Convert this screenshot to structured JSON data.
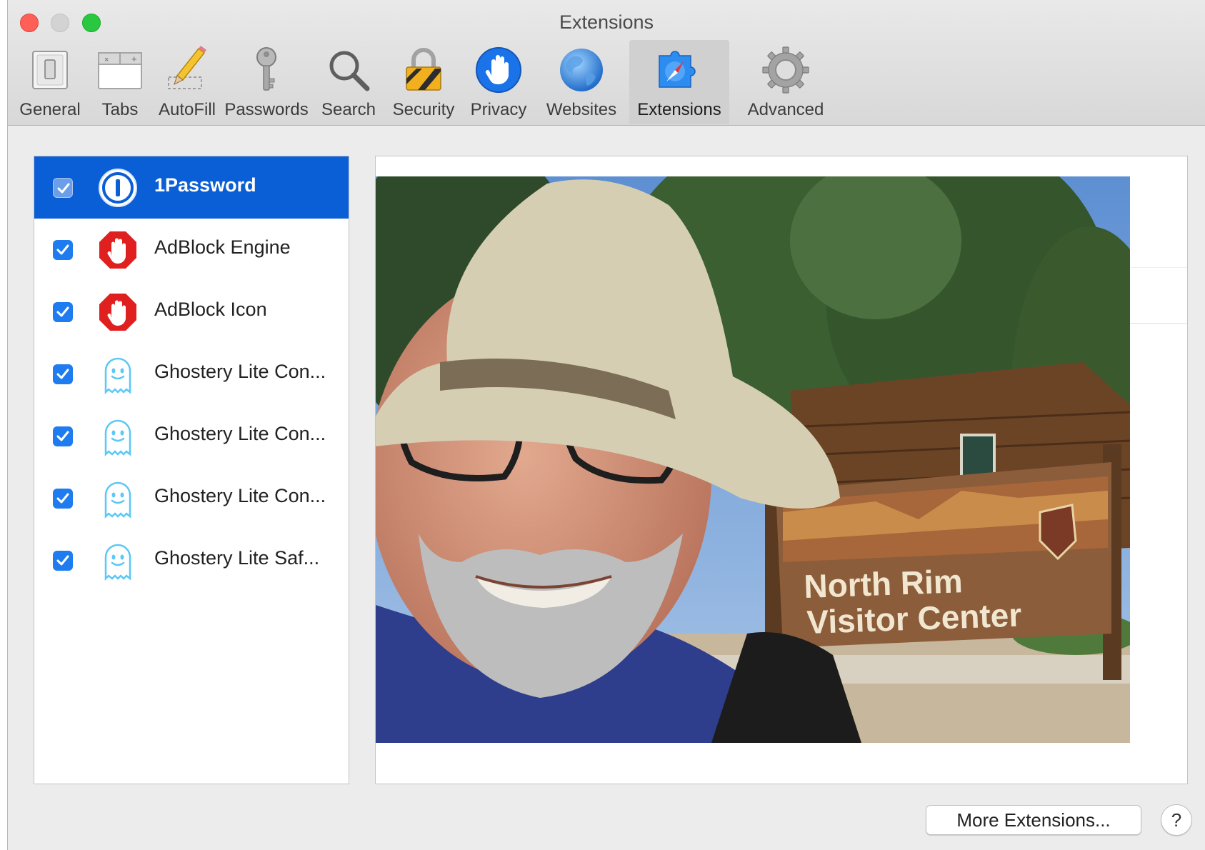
{
  "window": {
    "title": "Extensions"
  },
  "toolbar": {
    "tabs": [
      {
        "label": "General",
        "icon": "general-switch-icon"
      },
      {
        "label": "Tabs",
        "icon": "tabs-icon"
      },
      {
        "label": "AutoFill",
        "icon": "pencil-icon"
      },
      {
        "label": "Passwords",
        "icon": "key-icon"
      },
      {
        "label": "Search",
        "icon": "magnifier-icon"
      },
      {
        "label": "Security",
        "icon": "padlock-icon"
      },
      {
        "label": "Privacy",
        "icon": "hand-icon"
      },
      {
        "label": "Websites",
        "icon": "globe-icon"
      },
      {
        "label": "Extensions",
        "icon": "puzzle-compass-icon",
        "selected": true
      },
      {
        "label": "Advanced",
        "icon": "gear-icon"
      }
    ]
  },
  "extensions": {
    "items": [
      {
        "name": "1Password",
        "enabled": true,
        "selected": true,
        "icon": "onepassword-icon"
      },
      {
        "name": "AdBlock Engine",
        "enabled": true,
        "icon": "adblock-hand-icon"
      },
      {
        "name": "AdBlock Icon",
        "enabled": true,
        "icon": "adblock-hand-icon"
      },
      {
        "name": "Ghostery Lite Con...",
        "enabled": true,
        "icon": "ghost-icon"
      },
      {
        "name": "Ghostery Lite Con...",
        "enabled": true,
        "icon": "ghost-icon"
      },
      {
        "name": "Ghostery Lite Con...",
        "enabled": true,
        "icon": "ghost-icon"
      },
      {
        "name": "Ghostery Lite Saf...",
        "enabled": true,
        "icon": "ghost-icon"
      }
    ]
  },
  "detail": {
    "sign": {
      "line1": "North Rim",
      "line2": "Visitor Center"
    }
  },
  "footer": {
    "more_label": "More Extensions...",
    "help_label": "?"
  },
  "colors": {
    "selection": "#0a5fd6",
    "checkbox": "#1f7cf0",
    "adblock": "#e01f1f",
    "ghost": "#5bc8f5"
  }
}
